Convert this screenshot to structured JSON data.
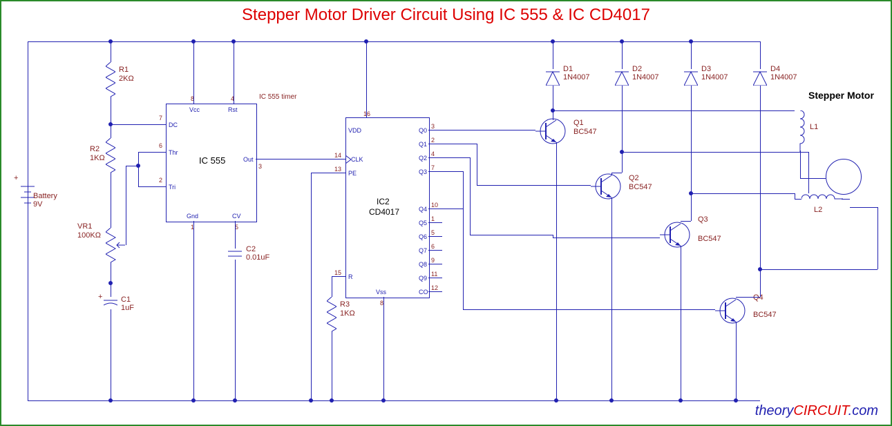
{
  "title": "Stepper Motor Driver Circuit Using IC 555 & IC CD4017",
  "battery": {
    "ref": "Battery",
    "val": "9V"
  },
  "r1": {
    "ref": "R1",
    "val": "2KΩ"
  },
  "r2": {
    "ref": "R2",
    "val": "1KΩ"
  },
  "r3": {
    "ref": "R3",
    "val": "1KΩ"
  },
  "vr1": {
    "ref": "VR1",
    "val": "100KΩ"
  },
  "c1": {
    "ref": "C1",
    "val": "1uF"
  },
  "c2": {
    "ref": "C2",
    "val": "0.01uF"
  },
  "ic555": {
    "name": "IC 555",
    "sub": "IC 555 timer",
    "pins": {
      "1": "Gnd",
      "2": "Tri",
      "3": "Out",
      "4": "Rst",
      "5": "CV",
      "6": "Thr",
      "7": "DC",
      "8": "Vcc"
    },
    "pn": {
      "1": "1",
      "2": "2",
      "3": "3",
      "4": "4",
      "5": "5",
      "6": "6",
      "7": "7",
      "8": "8"
    }
  },
  "ic4017": {
    "name": "IC2",
    "part": "CD4017",
    "pins": {
      "vdd": "VDD",
      "clk": "CLK",
      "pe": "PE",
      "r": "R",
      "vss": "Vss",
      "q0": "Q0",
      "q1": "Q1",
      "q2": "Q2",
      "q3": "Q3",
      "q4": "Q4",
      "q5": "Q5",
      "q6": "Q6",
      "q7": "Q7",
      "q8": "Q8",
      "q9": "Q9",
      "co": "CO"
    },
    "pn": {
      "vdd": "16",
      "clk": "14",
      "pe": "13",
      "r": "15",
      "vss": "8",
      "q0": "3",
      "q1": "2",
      "q2": "4",
      "q3": "7",
      "q4": "10",
      "q5": "1",
      "q6": "5",
      "q7": "6",
      "q8": "9",
      "q9": "11",
      "co": "12"
    }
  },
  "d1": {
    "ref": "D1",
    "val": "1N4007"
  },
  "d2": {
    "ref": "D2",
    "val": "1N4007"
  },
  "d3": {
    "ref": "D3",
    "val": "1N4007"
  },
  "d4": {
    "ref": "D4",
    "val": "1N4007"
  },
  "q1": {
    "ref": "Q1",
    "val": "BC547"
  },
  "q2": {
    "ref": "Q2",
    "val": "BC547"
  },
  "q3": {
    "ref": "Q3",
    "val": "BC547"
  },
  "q4": {
    "ref": "Q4",
    "val": "BC547"
  },
  "motor": {
    "label": "Stepper Motor",
    "l1": "L1",
    "l2": "L2"
  },
  "logo": {
    "a": "theory",
    "b": "CIRCUIT",
    "c": ".com"
  }
}
